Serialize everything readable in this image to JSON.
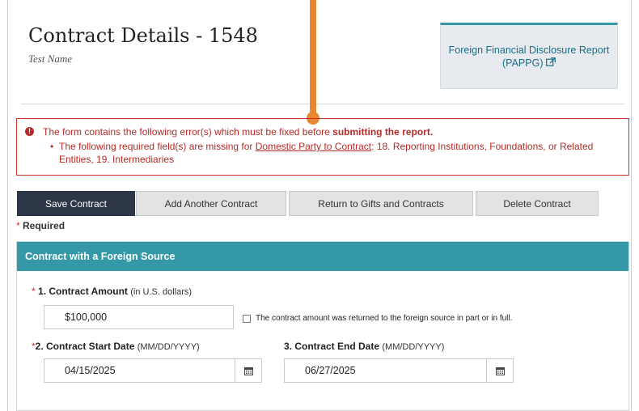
{
  "header": {
    "title": "Contract Details - 1548",
    "subtitle": "Test Name",
    "report_button_line1": "Foreign Financial Disclosure Report",
    "report_button_line2": "(PAPPG)",
    "report_button_icon": "external-link-icon"
  },
  "error": {
    "icon": "exclamation-circle-icon",
    "message_prefix": "The form contains the following error(s) which must be fixed before ",
    "message_bold": "submitting the report.",
    "bullet_prefix": "The following required field(s) are missing for ",
    "bullet_link": "Domestic Party to Contract",
    "bullet_suffix": ": 18. Reporting Institutions, Foundations, or Related Entities, 19. Intermediaries",
    "color": "#b52b27"
  },
  "toolbar": {
    "save_label": "Save Contract",
    "add_label": "Add Another Contract",
    "return_label": "Return to Gifts and Contracts",
    "delete_label": "Delete Contract"
  },
  "required_note": {
    "star": "*",
    "label": "Required"
  },
  "section": {
    "title": "Contract with a Foreign Source",
    "header_color": "#3598a6",
    "amount": {
      "star": "*",
      "label": "1. Contract Amount",
      "hint": "(in U.S. dollars)",
      "value": "$100,000",
      "checkbox_label": "The contract amount was returned to the foreign source in part or in full.",
      "checked": false
    },
    "start_date": {
      "star": "*",
      "label": "2. Contract Start Date",
      "hint": "(MM/DD/YYYY)",
      "value": "04/15/2025",
      "icon": "calendar-icon"
    },
    "end_date": {
      "label": "3. Contract End Date",
      "hint": "(MM/DD/YYYY)",
      "value": "06/27/2025",
      "icon": "calendar-icon"
    }
  },
  "colors": {
    "primary_button": "#2c3646",
    "annotation_pointer": "#e8872f"
  }
}
